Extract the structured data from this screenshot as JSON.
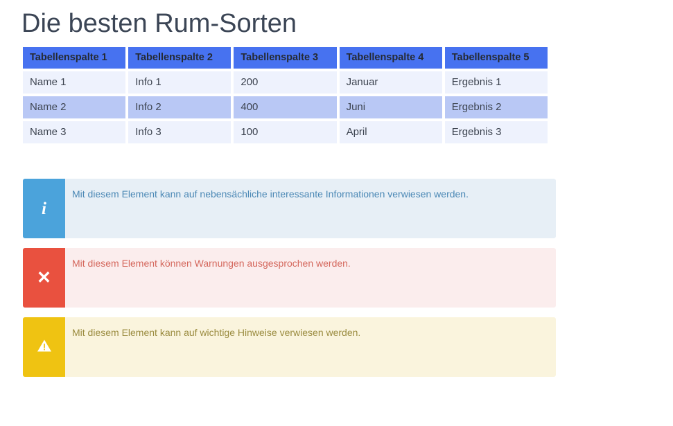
{
  "page": {
    "title": "Die besten Rum-Sorten"
  },
  "table": {
    "headers": [
      "Tabellenspalte 1",
      "Tabellenspalte 2",
      "Tabellenspalte 3",
      "Tabellenspalte 4",
      "Tabellenspalte 5"
    ],
    "rows": [
      [
        "Name 1",
        "Info 1",
        "200",
        "Januar",
        "Ergebnis 1"
      ],
      [
        "Name 2",
        "Info 2",
        "400",
        "Juni",
        "Ergebnis 2"
      ],
      [
        "Name 3",
        "Info 3",
        "100",
        "April",
        "Ergebnis 3"
      ]
    ]
  },
  "alerts": [
    {
      "kind": "info",
      "icon": "info-icon",
      "glyph": "i",
      "text": "Mit diesem Element kann auf nebensächliche interessante Informationen verwiesen werden.",
      "icon_color": "#4ba3db",
      "body_color": "#e7eff6",
      "text_color": "#4b88b5"
    },
    {
      "kind": "warning",
      "icon": "close-x-icon",
      "glyph": "✕",
      "text": "Mit diesem Element können Warnungen ausgesprochen werden.",
      "icon_color": "#e9513f",
      "body_color": "#fbeded",
      "text_color": "#d4675c"
    },
    {
      "kind": "note",
      "icon": "warning-triangle-icon",
      "glyph": "⚠",
      "text": "Mit diesem Element kann auf wichtige Hinweise verwiesen werden.",
      "icon_color": "#efc312",
      "body_color": "#faf4dd",
      "text_color": "#9a8b3f"
    }
  ],
  "colors": {
    "title": "#3b4555",
    "table_header_bg": "#4772f0",
    "table_header_text": "#252a33",
    "row_odd_bg": "#eef2fd",
    "row_even_bg": "#b9c8f5",
    "cell_text": "#3d4450"
  }
}
